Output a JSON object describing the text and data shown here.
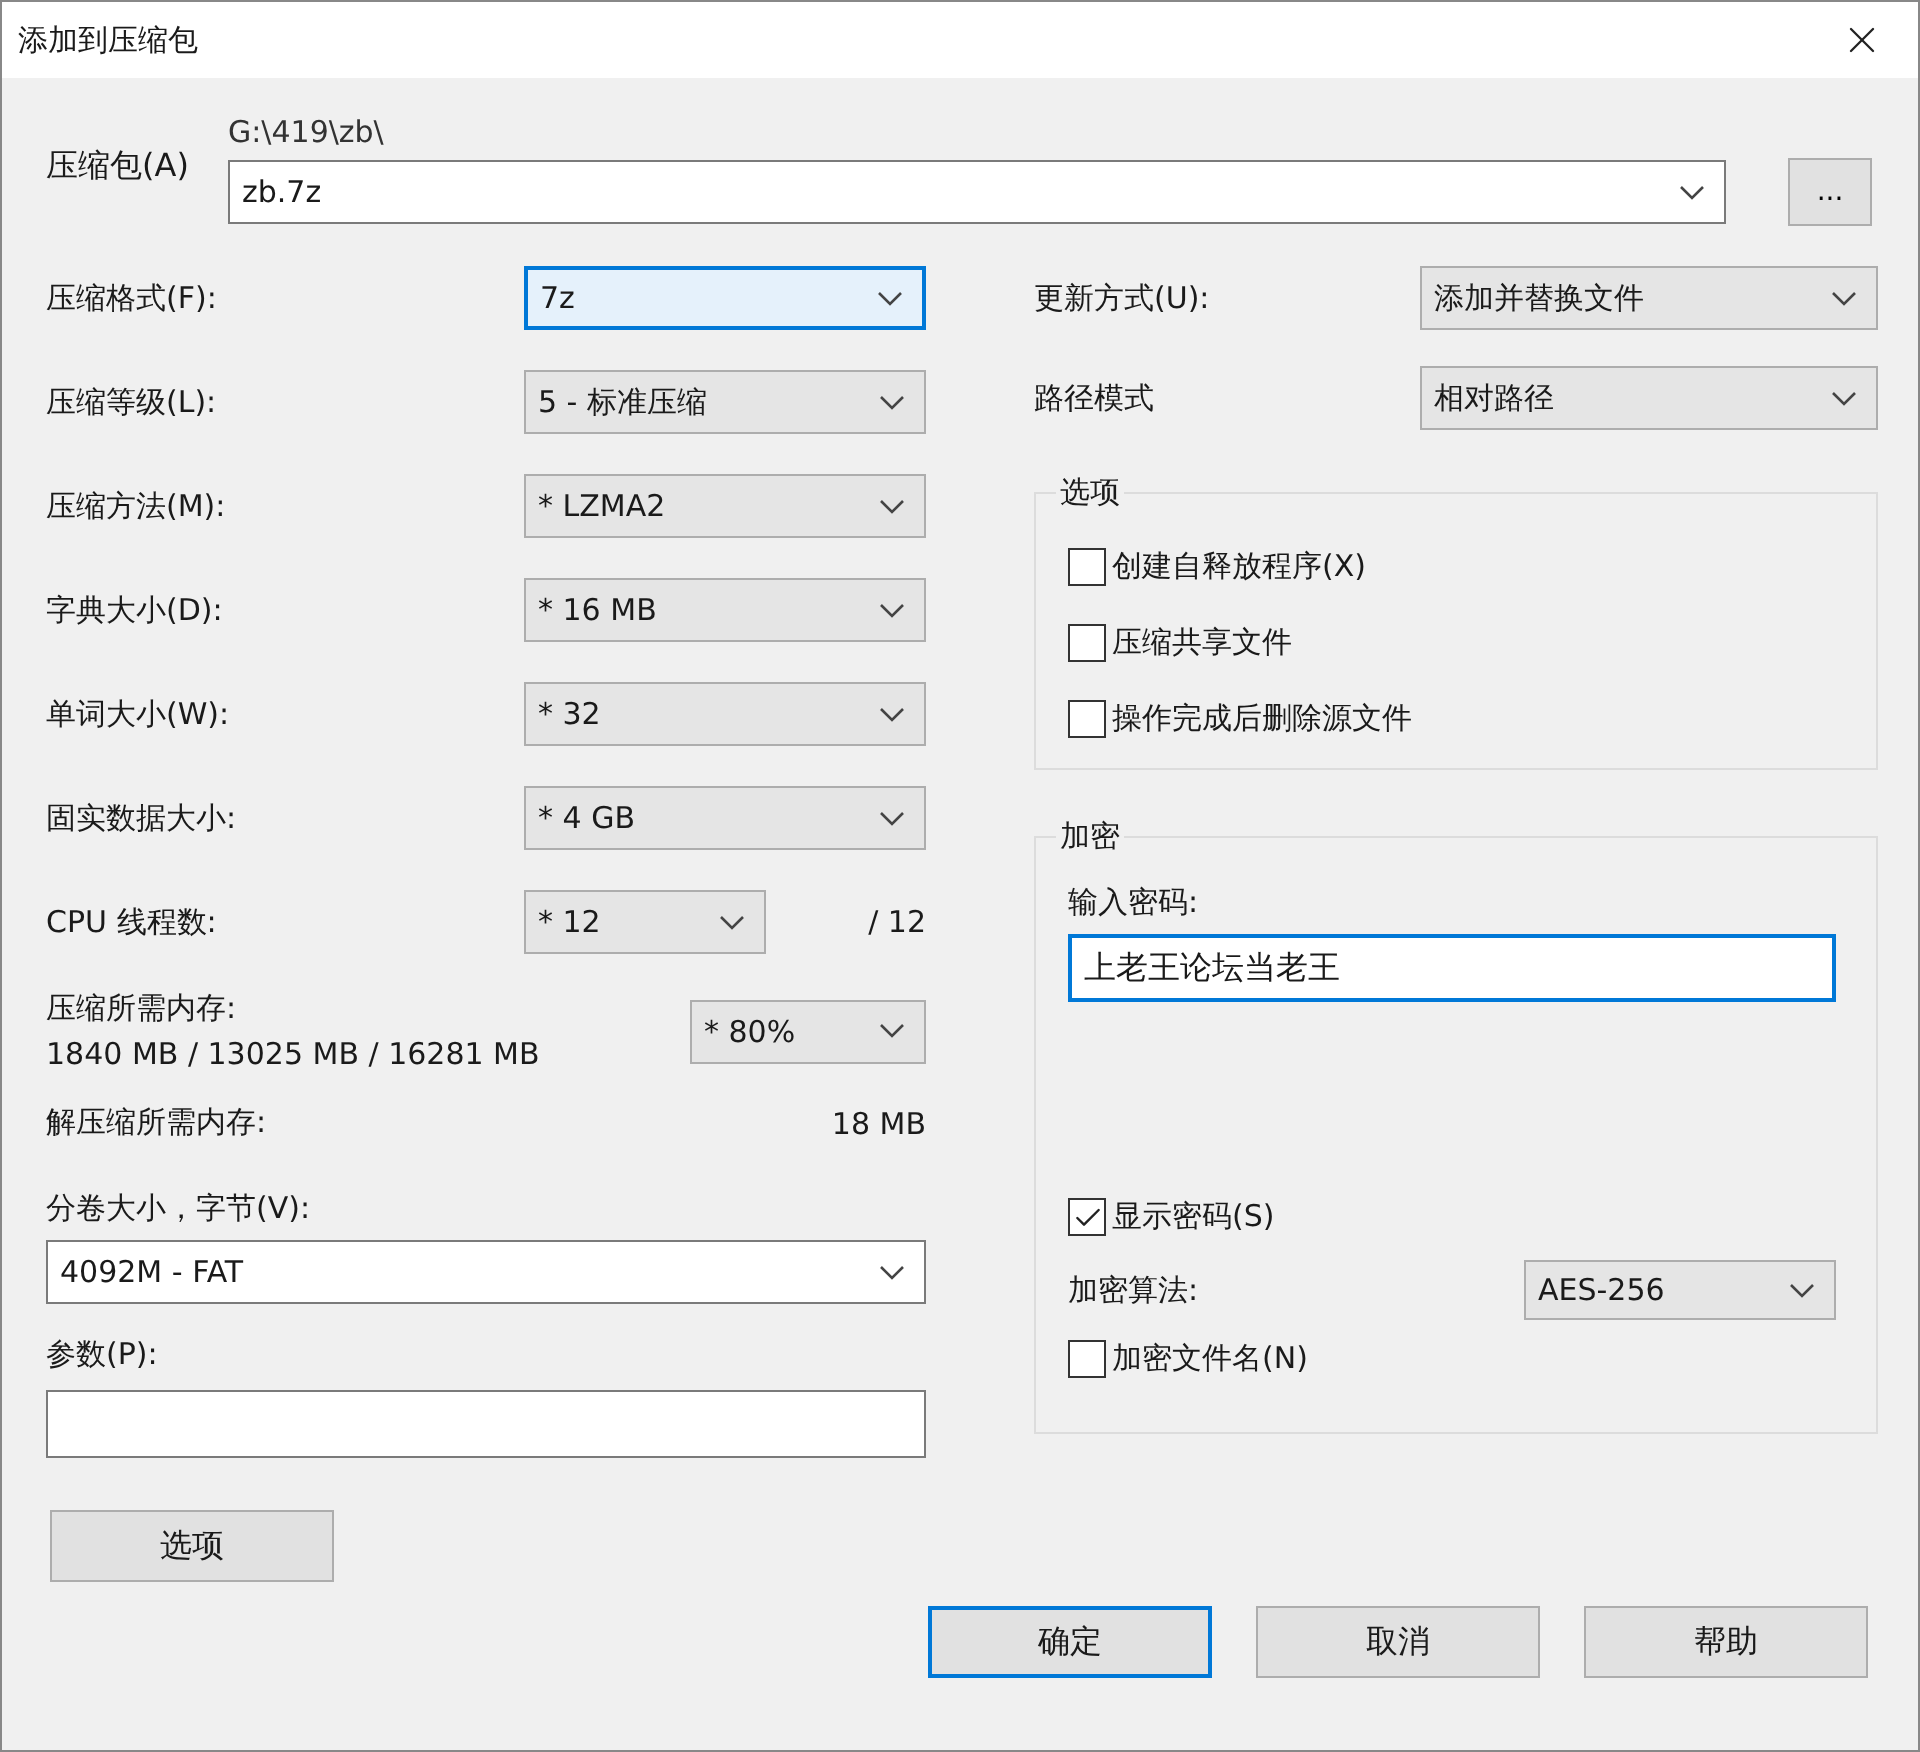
{
  "window": {
    "title": "添加到压缩包"
  },
  "archive": {
    "label": "压缩包(A)",
    "path": "G:\\419\\zb\\",
    "value": "zb.7z",
    "browse": "..."
  },
  "settings": [
    {
      "kind": "combo",
      "label": "压缩格式(F):",
      "value": "7z",
      "focused": true
    },
    {
      "kind": "combo",
      "label": "压缩等级(L):",
      "value": "5 - 标准压缩",
      "focused": false
    },
    {
      "kind": "combo",
      "label": "压缩方法(M):",
      "value": "* LZMA2",
      "focused": false
    },
    {
      "kind": "combo",
      "label": "字典大小(D):",
      "value": "* 16 MB",
      "focused": false
    },
    {
      "kind": "combo",
      "label": "单词大小(W):",
      "value": "* 32",
      "focused": false
    },
    {
      "kind": "combo",
      "label": "固实数据大小:",
      "value": "* 4 GB",
      "focused": false
    },
    {
      "kind": "threads",
      "label": "CPU 线程数:",
      "value": "* 12",
      "suffix": "/ 12",
      "focused": false
    },
    {
      "kind": "memory",
      "label": "压缩所需内存:",
      "detail": "1840 MB / 13025 MB / 16281 MB",
      "value": "* 80%",
      "focused": false
    },
    {
      "kind": "info",
      "label": "解压缩所需内存:",
      "value": "18 MB"
    }
  ],
  "volume": {
    "label": "分卷大小，字节(V):",
    "value": "4092M - FAT"
  },
  "parameters": {
    "label": "参数(P):"
  },
  "options_button": "选项",
  "update_mode": {
    "label": "更新方式(U):",
    "value": "添加并替换文件"
  },
  "path_mode": {
    "label": "路径模式",
    "value": "相对路径"
  },
  "options_group": {
    "title": "选项",
    "items": [
      {
        "label": "创建自释放程序(X)",
        "checked": false
      },
      {
        "label": "压缩共享文件",
        "checked": false
      },
      {
        "label": "操作完成后删除源文件",
        "checked": false
      }
    ]
  },
  "encryption": {
    "title": "加密",
    "password_label": "输入密码:",
    "password": "上老王论坛当老王",
    "show_password": {
      "label": "显示密码(S)",
      "checked": true
    },
    "method_label": "加密算法:",
    "method": "AES-256",
    "encrypt_names": {
      "label": "加密文件名(N)",
      "checked": false
    }
  },
  "buttons": [
    {
      "label": "确定",
      "default": true
    },
    {
      "label": "取消",
      "default": false
    },
    {
      "label": "帮助",
      "default": false
    }
  ]
}
